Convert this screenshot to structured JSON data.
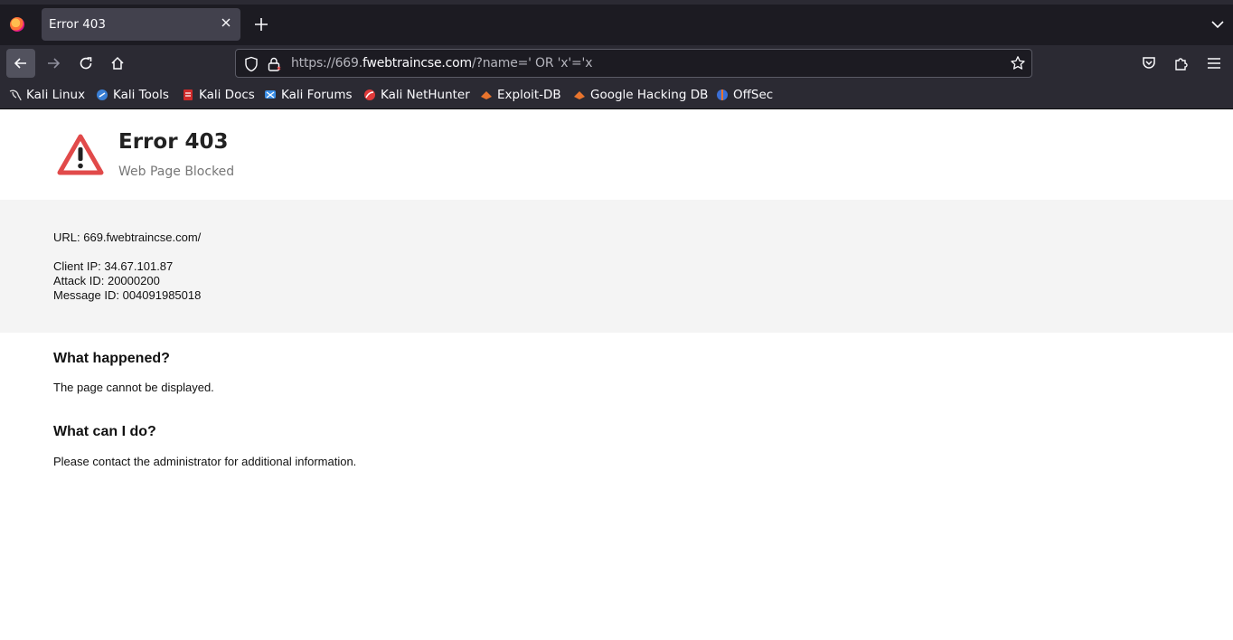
{
  "browser": {
    "tab_title": "Error 403",
    "url": {
      "scheme": "https://",
      "host_prefix": "669.",
      "host_main": "fwebtraincse.com",
      "path": "/?name=' OR 'x'='x"
    },
    "icons": {
      "back": "arrow-left-icon",
      "forward": "arrow-right-icon",
      "reload": "reload-icon",
      "home": "home-icon",
      "shield": "tracking-shield-icon",
      "lock": "lock-icon",
      "bookmark_star": "star-icon",
      "pocket": "pocket-icon",
      "extensions": "puzzle-icon",
      "menu": "hamburger-menu-icon"
    },
    "bookmarks": [
      {
        "label": "Kali Linux",
        "icon": "kali-dragon-icon",
        "color": "#dddddd"
      },
      {
        "label": "Kali Tools",
        "icon": "kali-tools-icon",
        "color": "#3a7fd5"
      },
      {
        "label": "Kali Docs",
        "icon": "kali-docs-icon",
        "color": "#d02a2a"
      },
      {
        "label": "Kali Forums",
        "icon": "kali-forums-icon",
        "color": "#3a8ee6"
      },
      {
        "label": "Kali NetHunter",
        "icon": "nethunter-icon",
        "color": "#e03a3a"
      },
      {
        "label": "Exploit-DB",
        "icon": "exploit-db-icon",
        "color": "#e8742d"
      },
      {
        "label": "Google Hacking DB",
        "icon": "ghdb-icon",
        "color": "#e8742d"
      },
      {
        "label": "OffSec",
        "icon": "offsec-icon",
        "color": "#3b6fd6"
      }
    ]
  },
  "page": {
    "title": "Error 403",
    "subtitle": "Web Page Blocked",
    "warning_color": "#e14a4a",
    "info": {
      "url": "URL: 669.fwebtraincse.com/",
      "client_ip": "Client IP: 34.67.101.87",
      "attack_id": "Attack ID: 20000200",
      "message_id": "Message ID: 004091985018"
    },
    "what_happened": {
      "heading": "What happened?",
      "text": "The page cannot be displayed."
    },
    "what_can_i_do": {
      "heading": "What can I do?",
      "text": "Please contact the administrator for additional information."
    }
  }
}
